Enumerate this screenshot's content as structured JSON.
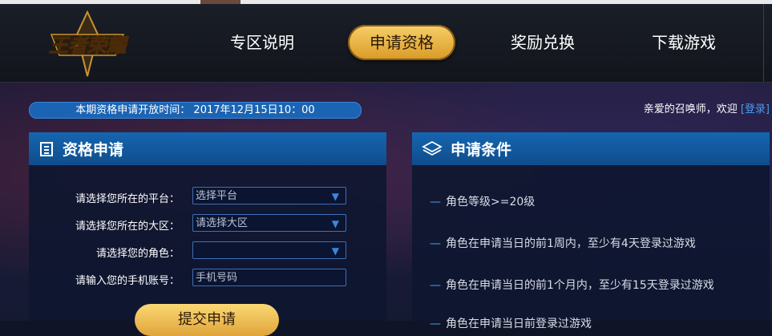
{
  "nav": {
    "items": [
      "专区说明",
      "申请资格",
      "奖励兑换",
      "下载游戏"
    ],
    "active_index": 1,
    "logo_text": "王者荣耀"
  },
  "notice": {
    "time_text": "本期资格申请开放时间： 2017年12月15日10：00"
  },
  "welcome": {
    "greeting": "亲爱的召唤师，欢迎",
    "login": "[登录]"
  },
  "apply_panel": {
    "title": "资格申请",
    "fields": [
      {
        "label": "请选择您所在的平台：",
        "value": "选择平台",
        "type": "select"
      },
      {
        "label": "请选择您所在的大区：",
        "value": "请选择大区",
        "type": "select"
      },
      {
        "label": "请选择您的角色：",
        "value": "",
        "type": "select"
      },
      {
        "label": "请输入您的手机账号：",
        "placeholder": "手机号码",
        "type": "input"
      }
    ],
    "submit_label": "提交申请"
  },
  "conditions_panel": {
    "title": "申请条件",
    "items": [
      "角色等级>=20级",
      "角色在申请当日的前1周内，至少有4天登录过游戏",
      "角色在申请当日的前1个月内，至少有15天登录过游戏",
      "角色在申请当日前登录过游戏"
    ]
  },
  "colors": {
    "accent_gold": "#e0a43a",
    "accent_blue": "#1566b0",
    "link_blue": "#4a9cf0"
  }
}
